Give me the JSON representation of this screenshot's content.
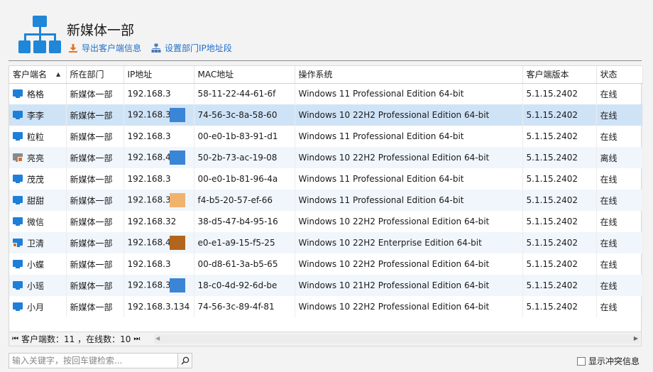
{
  "header": {
    "title": "新媒体一部",
    "export_label": "导出客户端信息",
    "ip_range_label": "设置部门IP地址段",
    "icon_color": "#1f86d8"
  },
  "table": {
    "columns": [
      "客户端名",
      "所在部门",
      "IP地址",
      "MAC地址",
      "操作系统",
      "客户端版本",
      "状态"
    ],
    "rows": [
      {
        "name": "格格",
        "dept": "新媒体一部",
        "ip": "192.168.3",
        "ip_tail": "",
        "mask_color": "",
        "mac": "58-11-22-44-61-6f",
        "os": "Windows 11 Professional Edition 64-bit",
        "version": "5.1.15.2402",
        "status": "在线",
        "icon": "monitor-icon",
        "offline": false
      },
      {
        "name": "李李",
        "dept": "新媒体一部",
        "ip": "192.168.3",
        "ip_tail": "",
        "mask_color": "#3a85d6",
        "mac": "74-56-3c-8a-58-60",
        "os": "Windows 10 22H2 Professional Edition 64-bit",
        "version": "5.1.15.2402",
        "status": "在线",
        "icon": "monitor-icon",
        "offline": false
      },
      {
        "name": "粒粒",
        "dept": "新媒体一部",
        "ip": "192.168.3",
        "ip_tail": "",
        "mask_color": "",
        "mac": "00-e0-1b-83-91-d1",
        "os": "Windows 11 Professional Edition 64-bit",
        "version": "5.1.15.2402",
        "status": "在线",
        "icon": "monitor-icon",
        "offline": false
      },
      {
        "name": "亮亮",
        "dept": "新媒体一部",
        "ip": "192.168.4",
        "ip_tail": "",
        "mask_color": "#3a85d6",
        "mac": "50-2b-73-ac-19-08",
        "os": "Windows 10 22H2 Professional Edition 64-bit",
        "version": "5.1.15.2402",
        "status": "离线",
        "icon": "monitor-locked-icon",
        "offline": true
      },
      {
        "name": "茂茂",
        "dept": "新媒体一部",
        "ip": "192.168.3",
        "ip_tail": "",
        "mask_color": "",
        "mac": "00-e0-1b-81-96-4a",
        "os": "Windows 11 Professional Edition 64-bit",
        "version": "5.1.15.2402",
        "status": "在线",
        "icon": "monitor-icon",
        "offline": false
      },
      {
        "name": "甜甜",
        "dept": "新媒体一部",
        "ip": "192.168.3",
        "ip_tail": "",
        "mask_color": "#f0b36e",
        "mac": "f4-b5-20-57-ef-66",
        "os": "Windows 11 Professional Edition 64-bit",
        "version": "5.1.15.2402",
        "status": "在线",
        "icon": "monitor-icon",
        "offline": false
      },
      {
        "name": "微信",
        "dept": "新媒体一部",
        "ip": "192.168.3",
        "ip_tail": "2",
        "mask_color": "",
        "mac": "38-d5-47-b4-95-16",
        "os": "Windows 10 22H2 Professional Edition 64-bit",
        "version": "5.1.15.2402",
        "status": "在线",
        "icon": "monitor-icon",
        "offline": false
      },
      {
        "name": "卫清",
        "dept": "新媒体一部",
        "ip": "192.168.4",
        "ip_tail": "",
        "mask_color": "#b2661d",
        "mac": "e0-e1-a9-15-f5-25",
        "os": "Windows 10 22H2 Enterprise Edition 64-bit",
        "version": "5.1.15.2402",
        "status": "在线",
        "icon": "monitor-alert-icon",
        "offline": false
      },
      {
        "name": "小蝶",
        "dept": "新媒体一部",
        "ip": "192.168.3",
        "ip_tail": "",
        "mask_color": "",
        "mac": "00-d8-61-3a-b5-65",
        "os": "Windows 10 22H2 Professional Edition 64-bit",
        "version": "5.1.15.2402",
        "status": "在线",
        "icon": "monitor-icon",
        "offline": false
      },
      {
        "name": "小瑶",
        "dept": "新媒体一部",
        "ip": "192.168.3",
        "ip_tail": "",
        "mask_color": "#3a85d6",
        "mac": "18-c0-4d-92-6d-be",
        "os": "Windows 10 21H2 Professional Edition 64-bit",
        "version": "5.1.15.2402",
        "status": "在线",
        "icon": "monitor-icon",
        "offline": false
      },
      {
        "name": "小月",
        "dept": "新媒体一部",
        "ip": "192.168.3",
        "ip_tail": ".134",
        "mask_color": "",
        "mac": "74-56-3c-89-4f-81",
        "os": "Windows 10 22H2 Professional Edition 64-bit",
        "version": "5.1.15.2402",
        "status": "在线",
        "icon": "monitor-icon",
        "offline": false
      }
    ]
  },
  "footer": {
    "count_text": "客户端数：11 ，在线数：10"
  },
  "search": {
    "placeholder": "输入关键字，按回车键检索..."
  },
  "conflict": {
    "label": "显示冲突信息",
    "checked": false
  },
  "colors": {
    "accent": "#2170c8",
    "selected_row": "#cfe3f7",
    "alt_row": "#f1f6fc",
    "monitor_blue": "#1e7fd8",
    "offline_gray": "#8a8a8a",
    "lock_orange": "#e46b1c"
  }
}
